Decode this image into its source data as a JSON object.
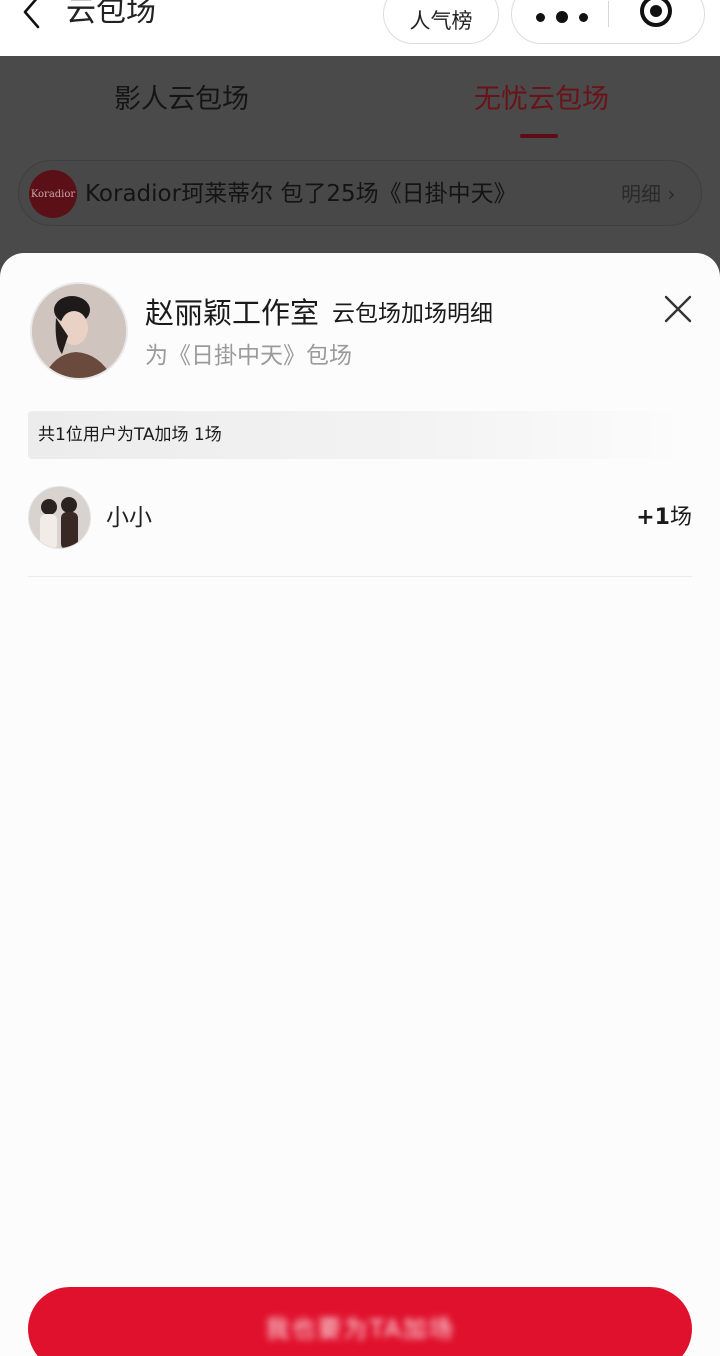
{
  "nav": {
    "title": "云包场",
    "rank_label": "人气榜",
    "back_icon": "chevron-left-icon",
    "more_icon": "more-dots-icon",
    "target_icon": "target-icon"
  },
  "tabs": [
    {
      "label": "影人云包场",
      "active": false
    },
    {
      "label": "无忧云包场",
      "active": true
    }
  ],
  "banner": {
    "logo_text": "Koradior",
    "text": "Koradior珂莱蒂尔 包了25场《日掛中天》",
    "detail_label": "明细"
  },
  "sheet": {
    "owner_name": "赵丽颖工作室",
    "title_suffix": "云包场加场明细",
    "subtitle": "为《日掛中天》包场",
    "summary": "共1位用户为TA加场 1场",
    "close_icon": "close-icon",
    "users": [
      {
        "name": "小小",
        "count_prefix": "+1",
        "count_unit": "场"
      }
    ],
    "action_label": "我也要为TA加场"
  },
  "colors": {
    "accent_red": "#e0112d",
    "active_tab": "#6a1218",
    "overlay": "#4a4a4a"
  }
}
